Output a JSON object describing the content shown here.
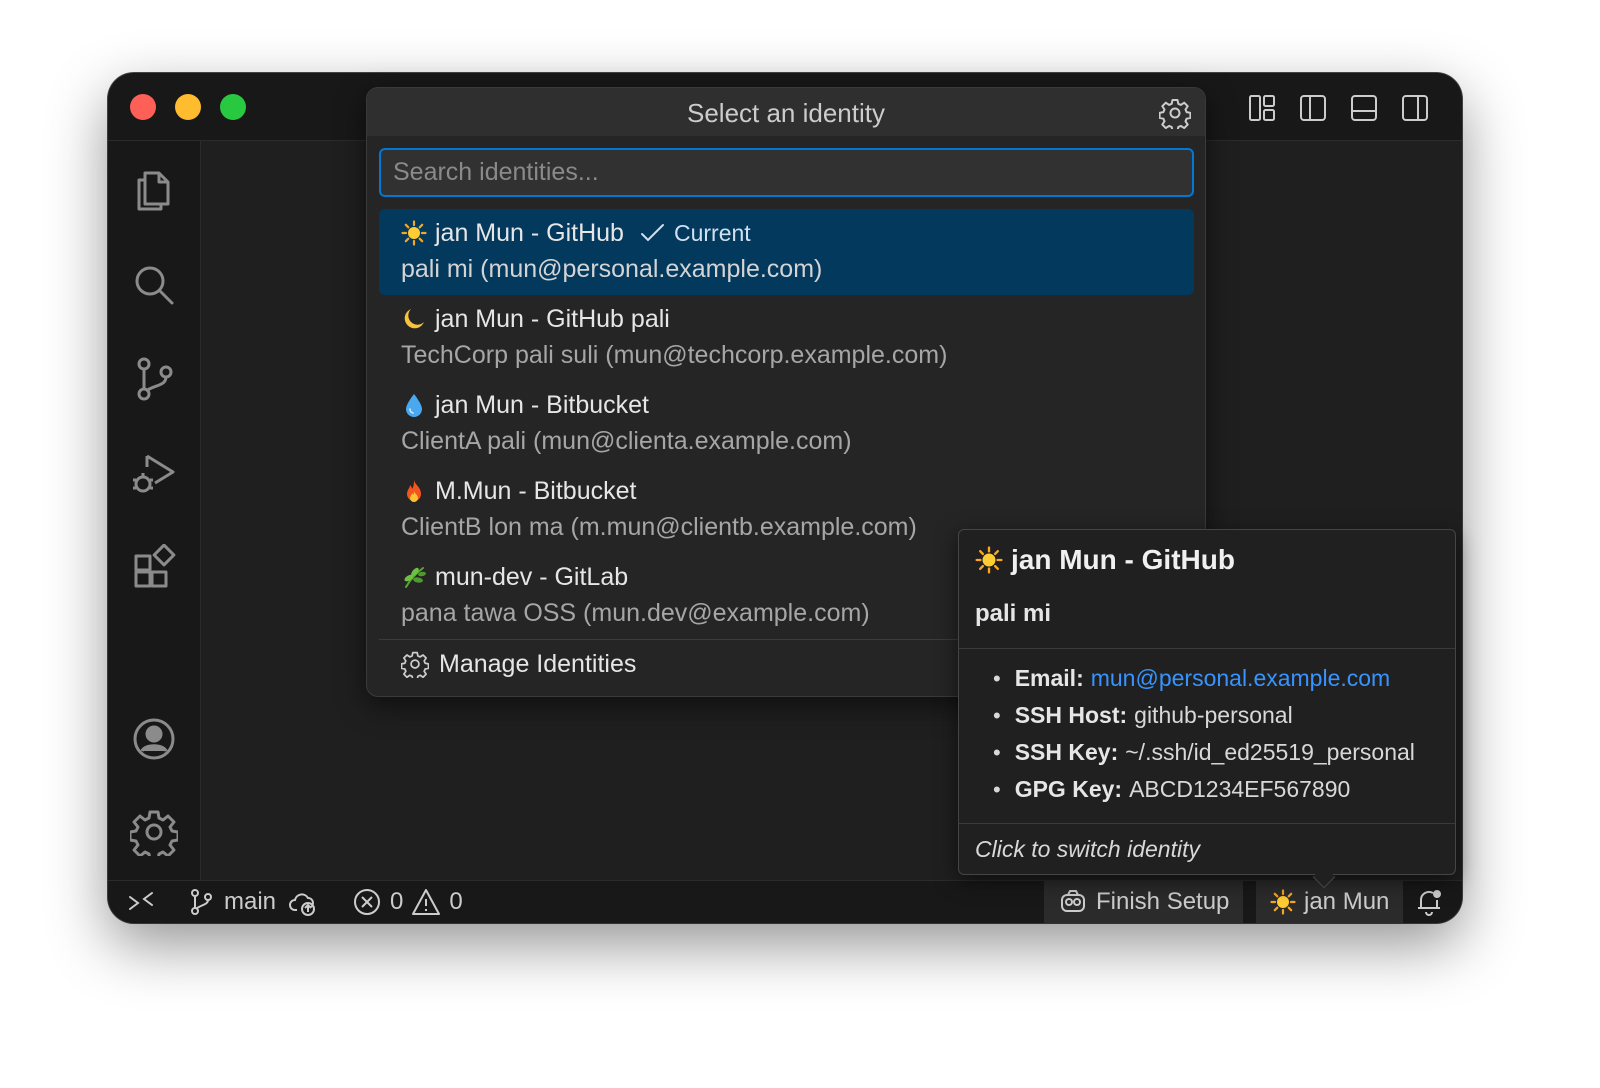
{
  "quick_pick": {
    "title": "Select an identity",
    "search_placeholder": "Search identities...",
    "items": [
      {
        "icon": "sun-icon",
        "label": "jan Mun - GitHub",
        "detail": "pali mi (mun@personal.example.com)",
        "badge": "Current",
        "selected": true
      },
      {
        "icon": "moon-icon",
        "label": "jan Mun - GitHub pali",
        "detail": "TechCorp pali suli (mun@techcorp.example.com)"
      },
      {
        "icon": "droplet-icon",
        "label": "jan Mun - Bitbucket",
        "detail": "ClientA pali (mun@clienta.example.com)"
      },
      {
        "icon": "fire-icon",
        "label": "M.Mun - Bitbucket",
        "detail": "ClientB lon ma (m.mun@clientb.example.com)"
      },
      {
        "icon": "herb-icon",
        "label": "mun-dev - GitLab",
        "detail": "pana tawa OSS (mun.dev@example.com)"
      }
    ],
    "manage_label": "Manage Identities"
  },
  "hover_card": {
    "title": "jan Mun - GitHub",
    "subtitle": "pali mi",
    "fields": {
      "email_label": "Email:",
      "email_value": "mun@personal.example.com",
      "ssh_host_label": "SSH Host:",
      "ssh_host_value": "github-personal",
      "ssh_key_label": "SSH Key:",
      "ssh_key_value": "~/.ssh/id_ed25519_personal",
      "gpg_key_label": "GPG Key:",
      "gpg_key_value": "ABCD1234EF567890"
    },
    "footer": "Click to switch identity"
  },
  "status_bar": {
    "branch": "main",
    "errors": "0",
    "warnings": "0",
    "finish_setup": "Finish Setup",
    "identity": "jan Mun"
  },
  "colors": {
    "accent": "#0078d4",
    "selection": "#04395e",
    "link": "#3794ff",
    "traffic_red": "#fe5f57",
    "traffic_yellow": "#febc2e",
    "traffic_green": "#28c840"
  }
}
